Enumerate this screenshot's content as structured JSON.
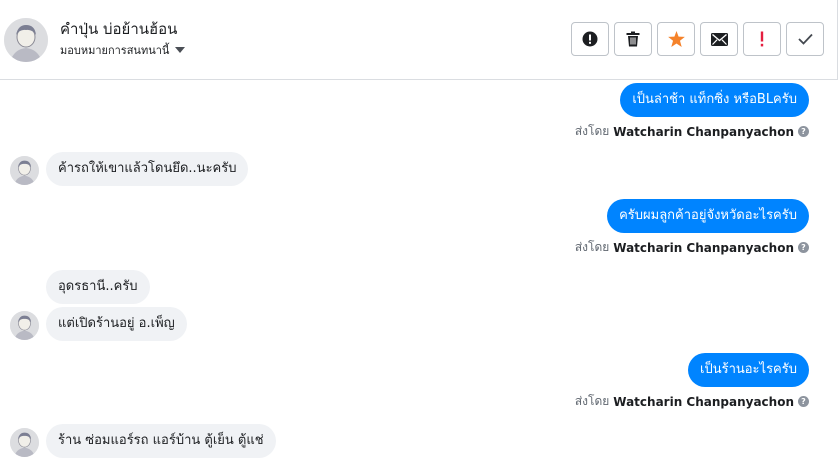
{
  "header": {
    "contact_name": "คำปุ่น บ่อย้านฮ้อน",
    "assign_label": "มอบหมายการสนทนานี้",
    "actions": [
      {
        "name": "spam",
        "icon": "alert-circle-icon"
      },
      {
        "name": "delete",
        "icon": "trash-icon"
      },
      {
        "name": "star",
        "icon": "star-icon"
      },
      {
        "name": "mark-unread",
        "icon": "envelope-icon"
      },
      {
        "name": "follow-up",
        "icon": "exclamation-icon"
      },
      {
        "name": "mark-done",
        "icon": "check-icon"
      }
    ]
  },
  "sent_by_prefix": "ส่งโดย",
  "agent_name": "Watcharin Chanpanyachon",
  "help_glyph": "?",
  "messages": [
    {
      "dir": "out",
      "text": "เป็นล่าช้า แท็กซิ่ง หรือBLครับ"
    },
    {
      "dir": "in",
      "text": "ค้ารถให้เขาแล้วโดนยึด..นะครับ"
    },
    {
      "dir": "out",
      "text": "ครับผมลูกค้าอยู่จังหวัดอะไรครับ"
    },
    {
      "dir": "in",
      "text": "อุดรธานี..ครับ"
    },
    {
      "dir": "in",
      "text": "แต่เปิดร้านอยู่ อ.เพ็ญ"
    },
    {
      "dir": "out",
      "text": "เป็นร้านอะไรครับ"
    },
    {
      "dir": "in",
      "text": "ร้าน ซ่อมแอร์รถ แอร์บ้าน ตู้เย็น ตู้แช่"
    }
  ],
  "colors": {
    "outgoing_bubble": "#0084ff",
    "incoming_bubble": "#f0f2f5",
    "star": "#f5822a",
    "follow_up": "#e41e3f"
  }
}
